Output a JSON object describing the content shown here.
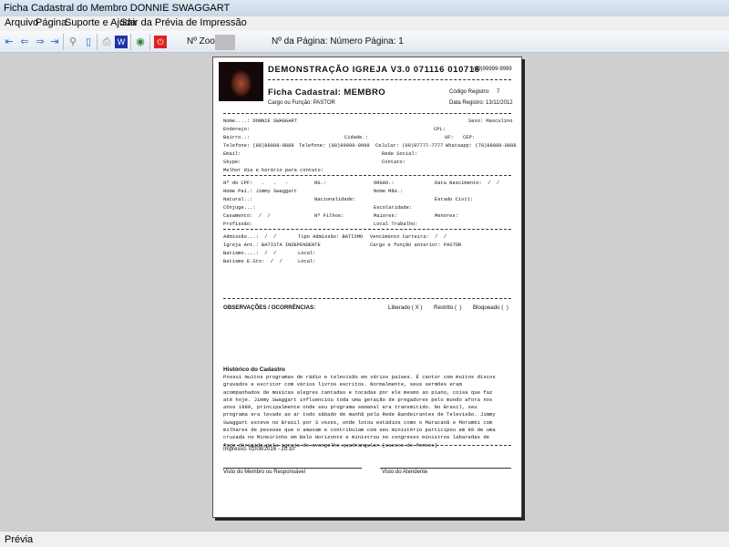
{
  "window": {
    "title": "Ficha Cadastral do Membro DONNIE SWAGGART"
  },
  "menu": [
    "Arquivo",
    "Página",
    "Suporte e Ajuda",
    "Sair da Prévia de Impressão"
  ],
  "toolbar": {
    "zoom_label": "Nº Zoom",
    "page_label": "Nº da Página: Número Página: 1"
  },
  "status": "Prévia",
  "doc": {
    "title": "DEMONSTRAÇÃO IGREJA V3.0 071116 010716",
    "phone": "(99)99999-9999",
    "subtitle": "Ficha Cadastral: MEMBRO",
    "cargo": "Cargo ou Função: PASTOR",
    "codigo_label": "Código Registro:",
    "codigo": "7",
    "data_registro": "Data Registro: 13/11/2012",
    "fields": {
      "nome": "Nome....: DONNIE SWAGGART",
      "sexo": "Sexo: Masculino",
      "endereco": "Endereço:",
      "cpl": "CPL:",
      "bairro": "Bairro..:",
      "cidade": "Cidade.:",
      "uf": "UF:",
      "cep": "CEP:",
      "tel1": "Telefone: (88)88888-8888",
      "tel2": "Telefone: (88)99999-9999",
      "celular": "Celular: (99)97777-7777",
      "whatsapp": "Whatsapp: (78)88888-8888",
      "email": "Email:",
      "rede": "Rede Social:",
      "skype": "Skype:",
      "contato": "Contato:",
      "melhor": "Melhor dia e horário para contato:",
      "cpf": "Nº do CPF:   .   .   -",
      "rg": "RG.:",
      "orgao": "ORGAO.:",
      "nasc": "Data Nascimento:  /  /",
      "pai": "Nome Pai.: Jimmy Swaggart",
      "mae": "Nome Mãe.:",
      "natural": "Natural..:",
      "nacionalidade": "Nacionalidade:",
      "civil": "Estado Civil:",
      "conjuge": "Cônjuge...:",
      "escolaridade": "Escolaridade:",
      "casamento": "Casamento:  /  /",
      "filhos": "Nº Filhos:",
      "maiores": "Maiores:",
      "menores": "Menores:",
      "profissao": "Profissão:",
      "trabalho": "Local Trabalho:",
      "admissao": "Admissão...:  /  /",
      "tipo": "Tipo Admissão: BATISMO",
      "vencimento": "Vencimento Carteira:  /  /",
      "igreja": "Igreja Ant.: BATISTA INDEPENDENTE",
      "cargo_ant": "Cargo e função anterior: PASTOR",
      "batismo": "Batismo....:  /  /",
      "local1": "Local:",
      "batismo_es": "Batismo E.Sto:  /  /",
      "local2": "Local:"
    },
    "obs": "OBSERVAÇÕES / OCORRÊNCIAS:",
    "liberado": "Liberado ( X )",
    "restrito": "Restrito (  )",
    "bloqueado": "Bloqueado (  )",
    "historico_title": "Histórico do Cadastro",
    "historico": [
      "Possui muitos programas de rádio e televisão em vários países. É cantor com muitos discos",
      "gravados e escritor com vários livros escritos. Normalmente, seus sermões eram",
      "acompanhados de músicas alegres cantadas e tocadas por ele mesmo ao piano, coisa que faz",
      "até hoje. Jimmy Swaggart influenciou toda uma geração de pregadores pelo mundo afora nos",
      "anos 1980, principalmente onde seu programa semanal era transmitido. No Brasil, seu",
      "programa era levado ao ar todo sábado de manhã pela Rede Bandeirantes de Televisão. Jimmy",
      "Swaggart esteve no Brasil por 3 vezes, onde lotou estádios como o Maracanã e Morumbi com",
      "milhares de pessoas que o amavam e contribuíam com seu ministério participou em 89 de uma",
      "cruzada no Mineirinho em Belo Horizonte e ministrou no congresso ministros labaredas de",
      "fogo dirigido pela igreja do evangelho quadrangular.[caesce de fontes]"
    ],
    "impresso": "Impresso: 02/08/2016 - 20:10",
    "visto_membro": "Visto do Membro ou Responsável",
    "visto_atendente": "Visto do Atendente"
  }
}
